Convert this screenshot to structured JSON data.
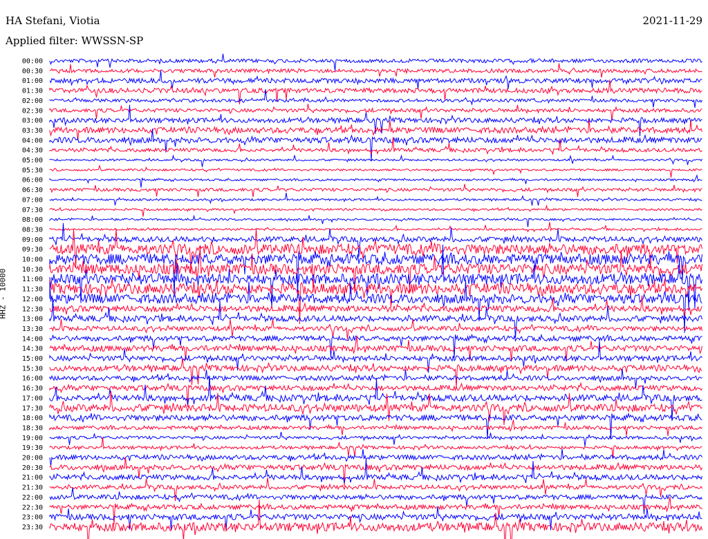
{
  "header": {
    "station": "HA Stefani, Viotia",
    "date": "2021-11-29",
    "filter": "Applied filter: WWSSN-SP"
  },
  "chart_data": {
    "type": "line",
    "title": "HA Stefani, Viotia",
    "ylabel": "HHZ - 10000",
    "row_labels": [
      "00:00",
      "00:30",
      "01:00",
      "01:30",
      "02:00",
      "02:30",
      "03:00",
      "03:30",
      "04:00",
      "04:30",
      "05:00",
      "05:30",
      "06:00",
      "06:30",
      "07:00",
      "07:30",
      "08:00",
      "08:30",
      "09:00",
      "09:30",
      "10:00",
      "10:30",
      "11:00",
      "11:30",
      "12:00",
      "12:30",
      "13:00",
      "13:30",
      "14:00",
      "14:30",
      "15:00",
      "15:30",
      "16:00",
      "16:30",
      "17:00",
      "17:30",
      "18:00",
      "18:30",
      "19:00",
      "19:30",
      "20:00",
      "20:30",
      "21:00",
      "21:30",
      "22:00",
      "22:30",
      "23:00",
      "23:30"
    ],
    "trace_colors": [
      "#0000ff",
      "#ff0033"
    ],
    "noise_level": [
      0.35,
      0.35,
      0.45,
      0.45,
      0.3,
      0.35,
      0.45,
      0.55,
      0.55,
      0.35,
      0.2,
      0.2,
      0.2,
      0.3,
      0.2,
      0.2,
      0.2,
      0.2,
      0.5,
      1.0,
      1.0,
      1.0,
      1.0,
      1.0,
      0.9,
      0.6,
      0.55,
      0.45,
      0.5,
      0.55,
      0.5,
      0.55,
      0.45,
      0.5,
      0.6,
      0.7,
      0.55,
      0.35,
      0.3,
      0.3,
      0.45,
      0.5,
      0.5,
      0.4,
      0.45,
      0.45,
      0.55,
      0.8
    ]
  }
}
